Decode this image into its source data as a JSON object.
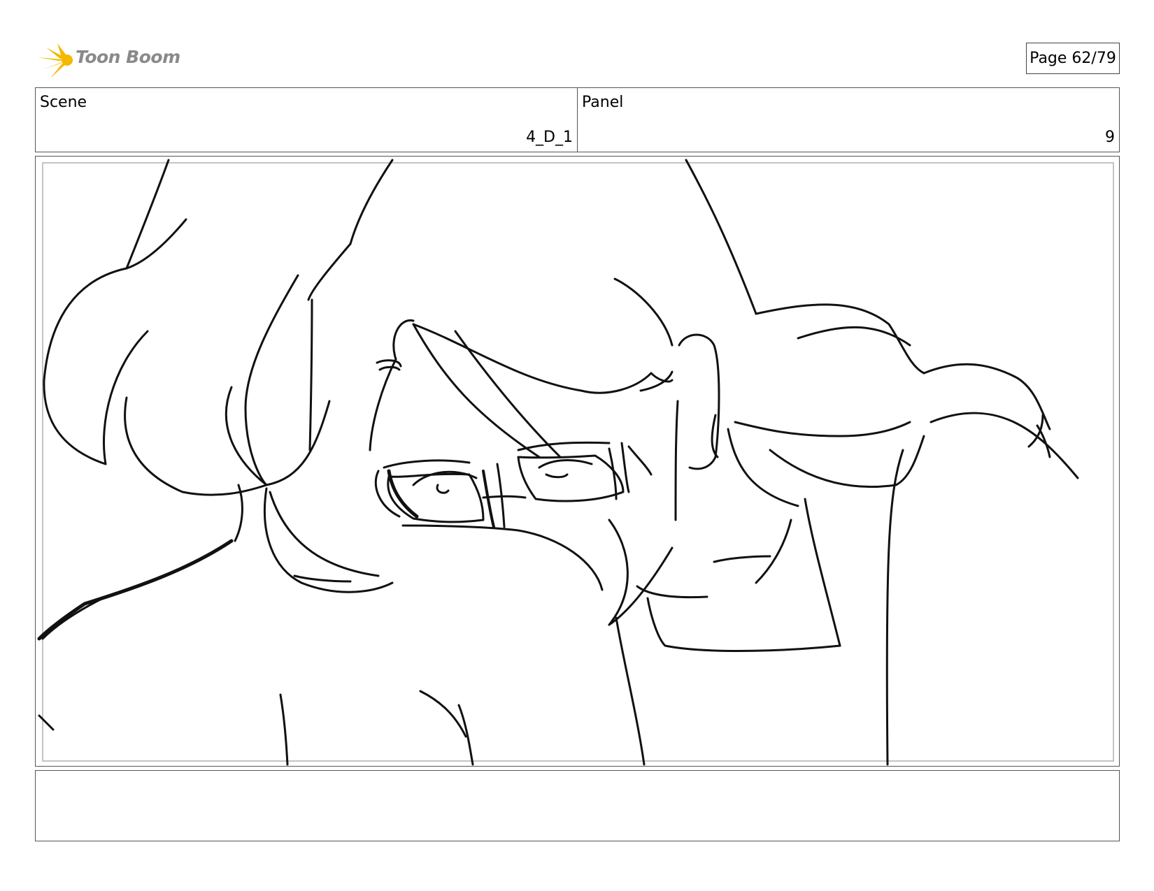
{
  "header": {
    "logo_text": "Toon Boom",
    "page_label": "Page 62/79"
  },
  "info": {
    "scene_label": "Scene",
    "scene_value": "4_D_1",
    "panel_label": "Panel",
    "panel_value": "9"
  },
  "colors": {
    "logo_star": "#f5b800",
    "logo_text": "#8a8a8a"
  },
  "notes": {
    "text": ""
  }
}
